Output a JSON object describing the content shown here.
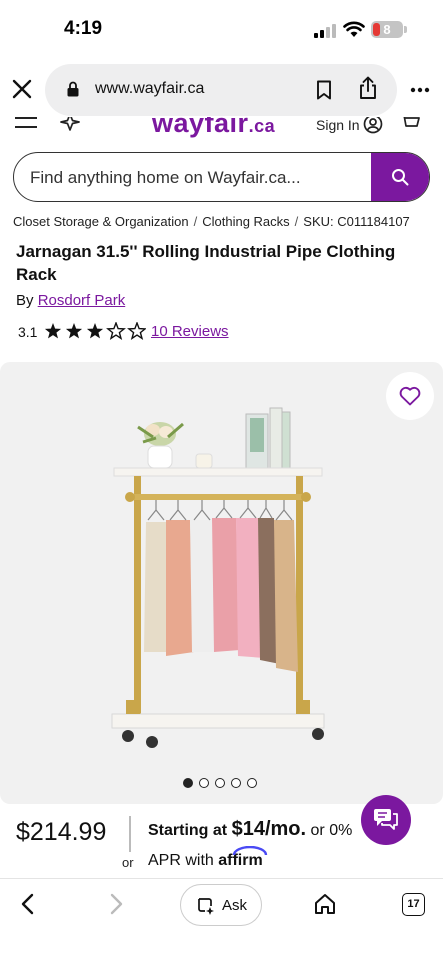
{
  "status_bar": {
    "time": "4:19",
    "battery_level": "8"
  },
  "browser": {
    "url": "www.wayfair.ca"
  },
  "site_header": {
    "logo_text": "wayfair",
    "logo_suffix": ".ca",
    "signin_label": "Sign In"
  },
  "search": {
    "placeholder": "Find anything home on Wayfair.ca..."
  },
  "breadcrumb": {
    "items": [
      "Closet Storage & Organization",
      "Clothing Racks"
    ],
    "sku": "SKU: C011184107"
  },
  "product": {
    "title": "Jarnagan 31.5'' Rolling Industrial Pipe Clothing Rack",
    "by_label": "By",
    "brand": "Rosdorf Park",
    "rating": "3.1",
    "rating_value": 3.1,
    "rating_max": 5,
    "reviews_label": "10 Reviews",
    "image_count": 5,
    "active_image": 1
  },
  "pricing": {
    "price": "$214.99",
    "or_label": "or",
    "starting_at": "Starting at",
    "monthly": "$14/mo.",
    "or_zero": "or 0%",
    "apr_with": "APR with",
    "affirm": "affirm"
  },
  "toolbar": {
    "ask_label": "Ask",
    "tab_count": "17"
  },
  "colors": {
    "brand_purple": "#7b189f",
    "image_bg": "#f1f1f1"
  }
}
